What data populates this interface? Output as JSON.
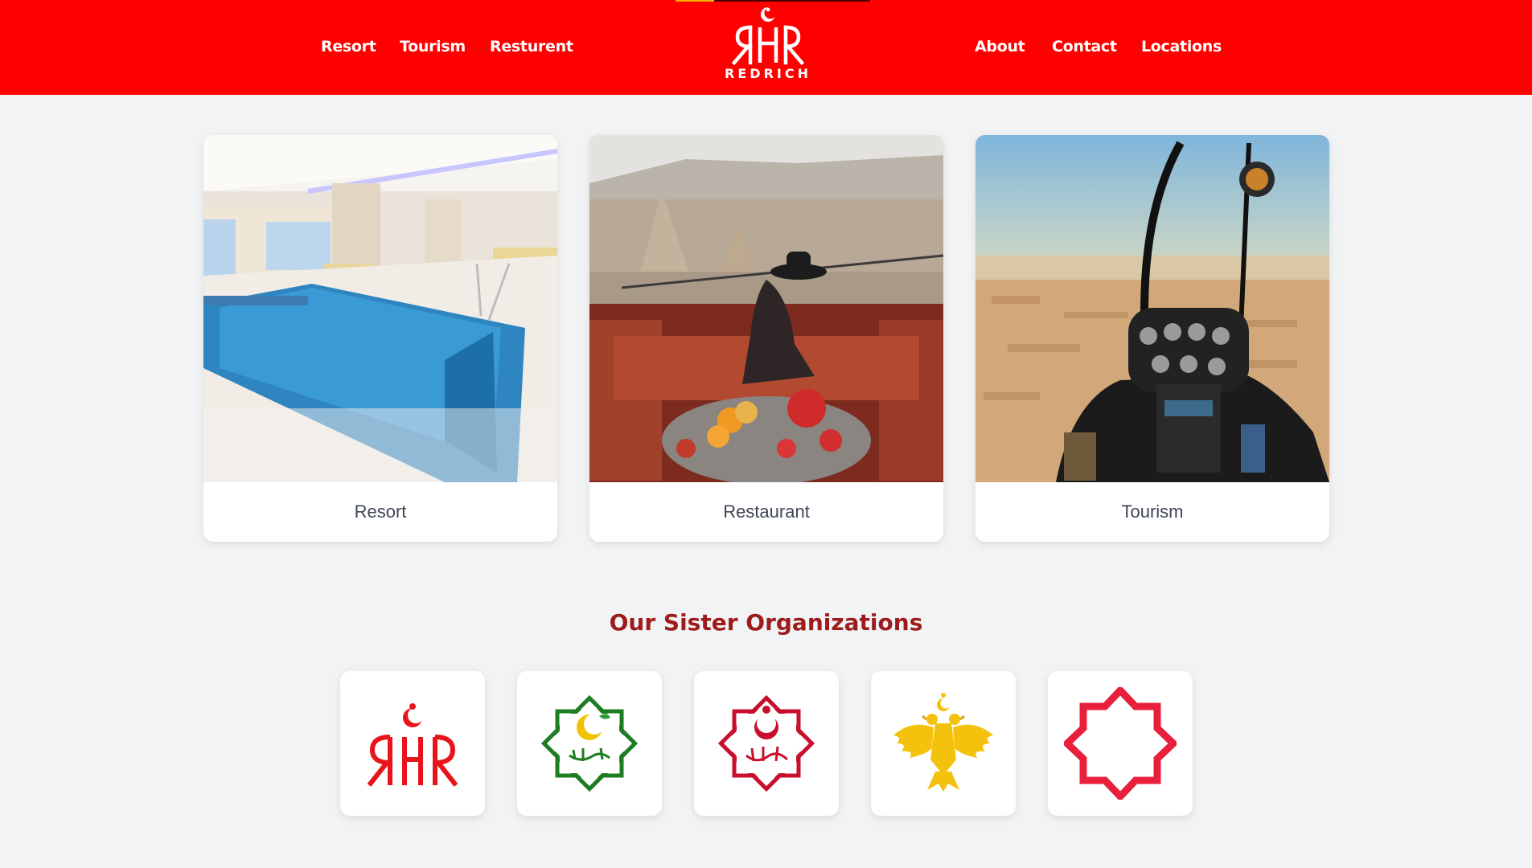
{
  "header": {
    "brand_name": "REDRICH",
    "nav_left": [
      "Resort",
      "Tourism",
      "Resturent"
    ],
    "nav_right": [
      "About",
      "Contact",
      "Locations"
    ],
    "background_color": "#ff0000"
  },
  "cards": [
    {
      "label": "Resort",
      "image": "indoor-swimming-pool-photo"
    },
    {
      "label": "Restaurant",
      "image": "rooftop-terrace-dining-photo"
    },
    {
      "label": "Tourism",
      "image": "helicopter-cockpit-city-view-photo"
    }
  ],
  "sister_orgs": {
    "title": "Our Sister Organizations",
    "title_color": "#9e1b1b",
    "logos": [
      {
        "icon": "redrich-monogram-logo",
        "color": "#e8141c"
      },
      {
        "icon": "green-crescent-star-logo",
        "color": "#1e7d22"
      },
      {
        "icon": "red-crescent-star-logo",
        "color": "#c8102e"
      },
      {
        "icon": "golden-double-eagle-logo",
        "color": "#f4c20d"
      },
      {
        "icon": "red-octagram-logo",
        "color": "#e8203e"
      }
    ]
  }
}
